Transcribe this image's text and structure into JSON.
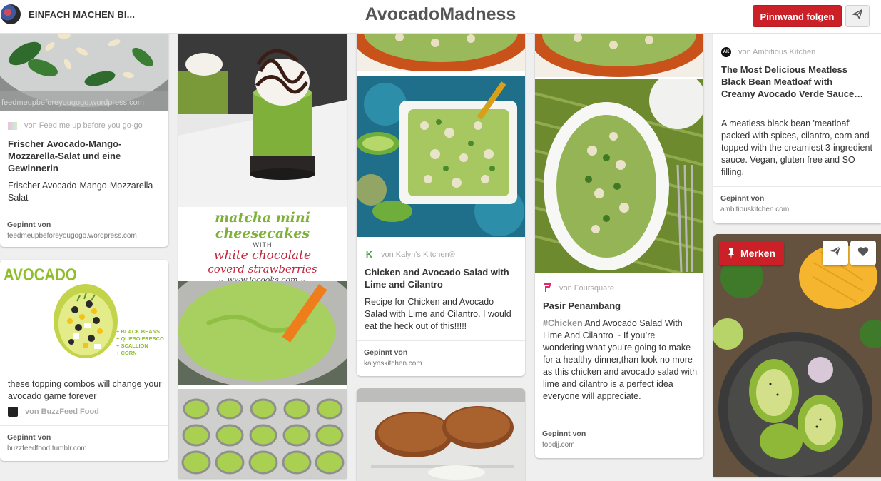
{
  "header": {
    "owner_name": "EINFACH MACHEN BI...",
    "board_title": "AvocadoMadness",
    "follow_label": "Pinnwand folgen"
  },
  "pinned_label": "Gepinnt von",
  "pins": {
    "p1": {
      "image_caption": "feedmeupbeforeyougogo.wordpress.com",
      "source": "von Feed me up before you go-go",
      "title": "Frischer Avocado-Mango-Mozzarella-Salat und eine Gewinnerin",
      "description": "Frischer Avocado-Mango-Mozzarella-Salat",
      "pinned_url": "feedmeupbeforeyougogo.wordpress.com"
    },
    "p2": {
      "image_text": {
        "heading": "AVOCADO",
        "items": [
          "+ BLACK BEANS",
          "+ QUESO FRESCO",
          "+ SCALLION",
          "+ CORN"
        ]
      },
      "description": "these topping combos will change your avocado game forever",
      "source": "von BuzzFeed Food",
      "pinned_url": "buzzfeedfood.tumblr.com"
    },
    "p3": {
      "image_text": {
        "line1": "matcha mini cheesecakes",
        "line2": "WITH",
        "line3": "white chocolate",
        "line4": "coverd strawberries",
        "line5": "~ www.jocooks.com ~"
      }
    },
    "p4": {
      "source": "von Kalyn's Kitchen®",
      "title": "Chicken and Avocado Salad with Lime and Cilantro",
      "description": "Recipe for Chicken and Avocado Salad with Lime and Cilantro. I would eat the heck out of this!!!!!",
      "pinned_url": "kalynskitchen.com"
    },
    "p5": {
      "source": "von Foursquare",
      "title": "Pasir Penambang",
      "hashtag": "#Chicken",
      "description": " And Avocado Salad With Lime And Cilantro ~ If you’re wondering what you’re going to make for a healthy dinner,than look no more as this chicken and avocado salad with lime and cilantro is a perfect idea everyone will appreciate.",
      "pinned_url": "foodjj.com"
    },
    "p6": {
      "source": "von Ambitious Kitchen",
      "source_icon_text": "AK",
      "title": "The Most Delicious Meatless Black Bean Meatloaf with Creamy Avocado Verde Sauce…",
      "description": "A meatless black bean 'meatloaf' packed with spices, cilantro, corn and topped with the creamiest 3-ingredient sauce. Vegan, gluten free and SO filling.",
      "pinned_url": "ambitiouskitchen.com"
    },
    "p7": {
      "save_label": "Merken"
    }
  },
  "colors": {
    "brand_red": "#cb2027",
    "background": "#efefef",
    "card": "#ffffff"
  },
  "icons": [
    "send-icon",
    "pin-icon",
    "heart-icon",
    "source-icon"
  ]
}
